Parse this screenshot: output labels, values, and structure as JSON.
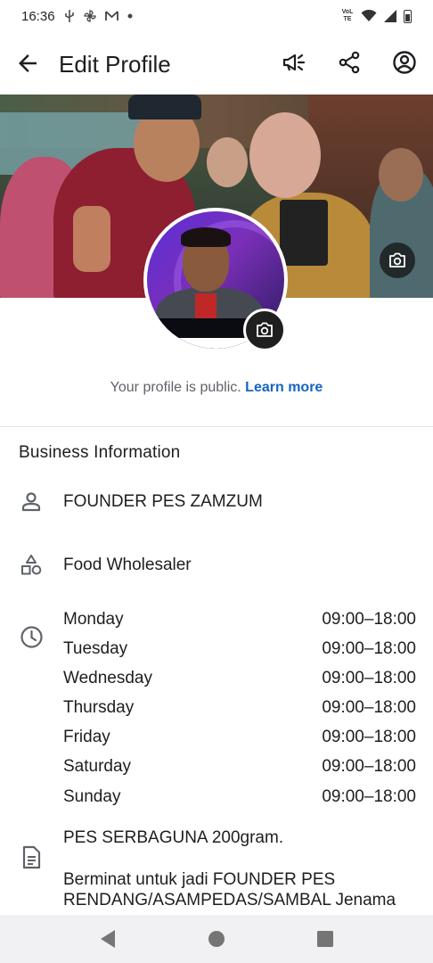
{
  "status_bar": {
    "time": "16:36",
    "notification_icons": [
      "usb-icon",
      "pinwheel-app-icon",
      "gmail-icon",
      "dot-icon"
    ],
    "volte_label": "VoLTE",
    "right_icons": [
      "wifi-icon",
      "cellular-signal-icon",
      "battery-icon"
    ]
  },
  "app_bar": {
    "title": "Edit Profile",
    "actions": [
      "megaphone-icon",
      "share-icon",
      "account-circle-icon"
    ]
  },
  "profile": {
    "public_notice": "Your profile is public.",
    "learn_more": "Learn more"
  },
  "business_info": {
    "title": "Business Information",
    "name": "FOUNDER PES ZAMZUM",
    "category": "Food Wholesaler",
    "hours": [
      {
        "day": "Monday",
        "time": "09:00–18:00"
      },
      {
        "day": "Tuesday",
        "time": "09:00–18:00"
      },
      {
        "day": "Wednesday",
        "time": "09:00–18:00"
      },
      {
        "day": "Thursday",
        "time": "09:00–18:00"
      },
      {
        "day": "Friday",
        "time": "09:00–18:00"
      },
      {
        "day": "Saturday",
        "time": "09:00–18:00"
      },
      {
        "day": "Sunday",
        "time": "09:00–18:00"
      }
    ],
    "description_line1": "PES SERBAGUNA 200gram.",
    "description_line2": "Berminat untuk jadi FOUNDER PES RENDANG/ASAMPEDAS/SAMBAL Jenama"
  },
  "colors": {
    "link": "#1565c0",
    "text": "#1c1e21",
    "muted": "#5f6368",
    "nav_bar": "#f1f1f3"
  }
}
